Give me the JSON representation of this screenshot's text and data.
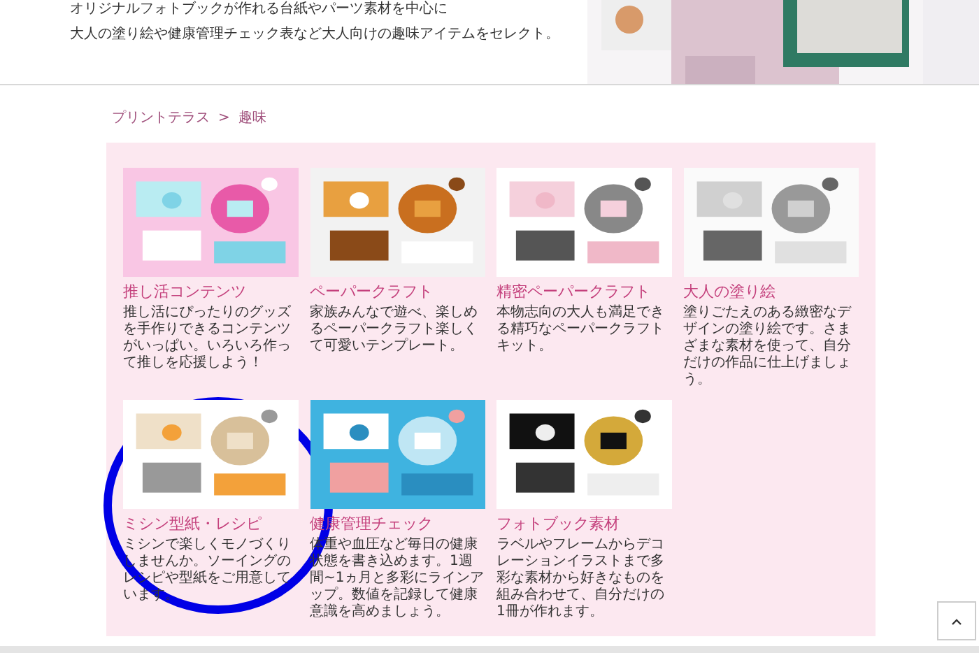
{
  "intro": {
    "lines": [
      "オリジナルフォトブックが作れる台紙やパーツ素材を中心に",
      "大人の塗り絵や健康管理チェック表など大人向けの趣味アイテムをセレクト。"
    ],
    "banner": {
      "kind": "picture"
    }
  },
  "breadcrumb": [
    "プリントテラス",
    ">",
    "趣味"
  ],
  "items": [
    {
      "title": "推し活コンテンツ",
      "description": "推し活にぴったりのグッズを手作りできるコンテンツがいっぱい。いろいろ作って推しを応援しよう！",
      "image": {
        "kind": "picture"
      }
    },
    {
      "title": "ペーパークラフト",
      "description": "家族みんなで遊べ、楽しめるペーパークラフト楽しくて可愛いテンプレート。",
      "image": {
        "kind": "picture"
      }
    },
    {
      "title": "精密ペーパークラフト",
      "description": "本物志向の大人も満足できる精巧なペーパークラフトキット。",
      "image": {
        "kind": "picture"
      }
    },
    {
      "title": "大人の塗り絵",
      "description": "塗りごたえのある緻密なデザインの塗り絵です。さまざまな素材を使って、自分だけの作品に仕上げましょう。",
      "image": {
        "kind": "picture"
      }
    },
    {
      "title": "ミシン型紙・レシピ",
      "description": "ミシンで楽しくモノづくりしませんか。ソーイングのレシピや型紙をご用意しています。",
      "image": {
        "kind": "picture"
      }
    },
    {
      "title": "健康管理チェック",
      "description": "体重や血圧など毎日の健康状態を書き込めます。1週間~1ヵ月と多彩にラインアップ。数値を記録して健康意識を高めましょう。",
      "image": {
        "kind": "picture"
      }
    },
    {
      "title": "フォトブック素材",
      "description": "ラベルやフレームからデコレーションイラストまで多彩な素材から好きなものを組み合わせて、自分だけの1冊が作れます。",
      "image": {
        "kind": "picture"
      }
    }
  ],
  "highlight": {
    "kind": "circle"
  },
  "scroll_top": {
    "kind": "button"
  }
}
